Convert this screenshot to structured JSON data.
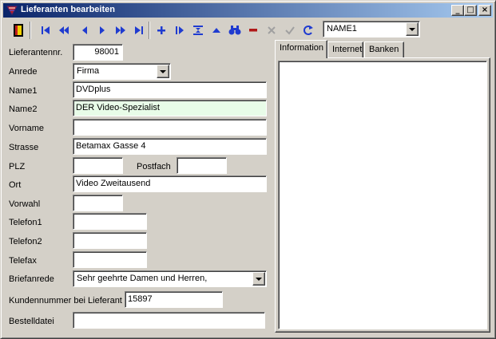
{
  "window": {
    "title": "Lieferanten bearbeiten",
    "minimize_label": "_",
    "maximize_label": "□",
    "close_label": "×"
  },
  "toolbar": {
    "buttons": [
      "exit",
      "first-record",
      "previous-page",
      "previous-record",
      "next-record",
      "next-page",
      "last-record",
      "insert-record",
      "edit-record",
      "fit",
      "up",
      "search",
      "delete",
      "cancel",
      "post",
      "refresh"
    ],
    "sort_field": {
      "value": "NAME1"
    }
  },
  "form": {
    "lieferantennr": {
      "label": "Lieferantennr.",
      "value": "98001"
    },
    "anrede": {
      "label": "Anrede",
      "value": "Firma"
    },
    "name1": {
      "label": "Name1",
      "value": "DVDplus"
    },
    "name2": {
      "label": "Name2",
      "value": "DER Video-Spezialist"
    },
    "vorname": {
      "label": "Vorname",
      "value": ""
    },
    "strasse": {
      "label": "Strasse",
      "value": "Betamax Gasse 4"
    },
    "plz": {
      "label": "PLZ",
      "value": ""
    },
    "postfach": {
      "label": "Postfach",
      "value": ""
    },
    "ort": {
      "label": "Ort",
      "value": "Video Zweitausend"
    },
    "vorwahl": {
      "label": "Vorwahl",
      "value": ""
    },
    "telefon1": {
      "label": "Telefon1",
      "value": ""
    },
    "telefon2": {
      "label": "Telefon2",
      "value": ""
    },
    "telefax": {
      "label": "Telefax",
      "value": ""
    },
    "briefanrede": {
      "label": "Briefanrede",
      "value": "Sehr geehrte Damen und Herren,"
    },
    "kundennummer": {
      "label": "Kundennummer bei Lieferant",
      "value": "15897"
    },
    "bestelldatei": {
      "label": "Bestelldatei",
      "value": ""
    }
  },
  "tabs": [
    {
      "label": "Information",
      "active": true
    },
    {
      "label": "Internet",
      "active": false
    },
    {
      "label": "Banken",
      "active": false
    }
  ],
  "colors": {
    "title_start": "#0a246a",
    "title_end": "#a6caf0",
    "nav_blue": "#1f3bd0",
    "delete_red": "#b01818",
    "name2_bg": "#e8fce8"
  }
}
